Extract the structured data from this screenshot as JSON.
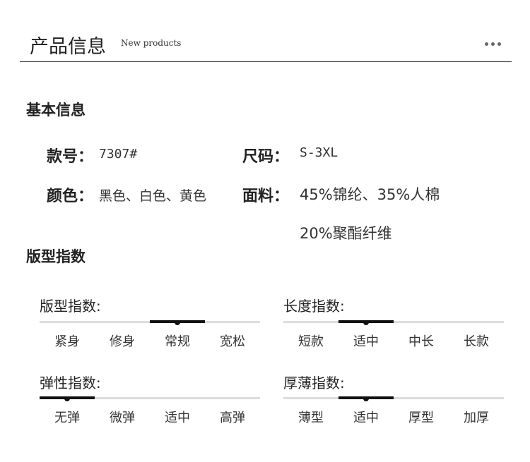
{
  "header": {
    "title": "产品信息",
    "subtitle": "New products",
    "more_icon": "more-dots-icon"
  },
  "basic": {
    "title": "基本信息",
    "style_no": {
      "label": "款号：",
      "value": "7307#"
    },
    "size": {
      "label": "尺码：",
      "value": "S-3XL"
    },
    "color": {
      "label": "颜色：",
      "value": "黑色、白色、黄色"
    },
    "fabric": {
      "label": "面料：",
      "value_line1": "45%锦纶、35%人棉",
      "value_line2": "20%聚酯纤维"
    }
  },
  "fit": {
    "title": "版型指数",
    "groups": [
      {
        "label": "版型指数:",
        "options": [
          "紧身",
          "修身",
          "常规",
          "宽松"
        ],
        "selected": 2
      },
      {
        "label": "长度指数:",
        "options": [
          "短款",
          "适中",
          "中长",
          "长款"
        ],
        "selected": 1
      },
      {
        "label": "弹性指数:",
        "options": [
          "无弹",
          "微弹",
          "适中",
          "高弹"
        ],
        "selected": 0
      },
      {
        "label": "厚薄指数:",
        "options": [
          "薄型",
          "适中",
          "厚型",
          "加厚"
        ],
        "selected": 1
      }
    ]
  }
}
